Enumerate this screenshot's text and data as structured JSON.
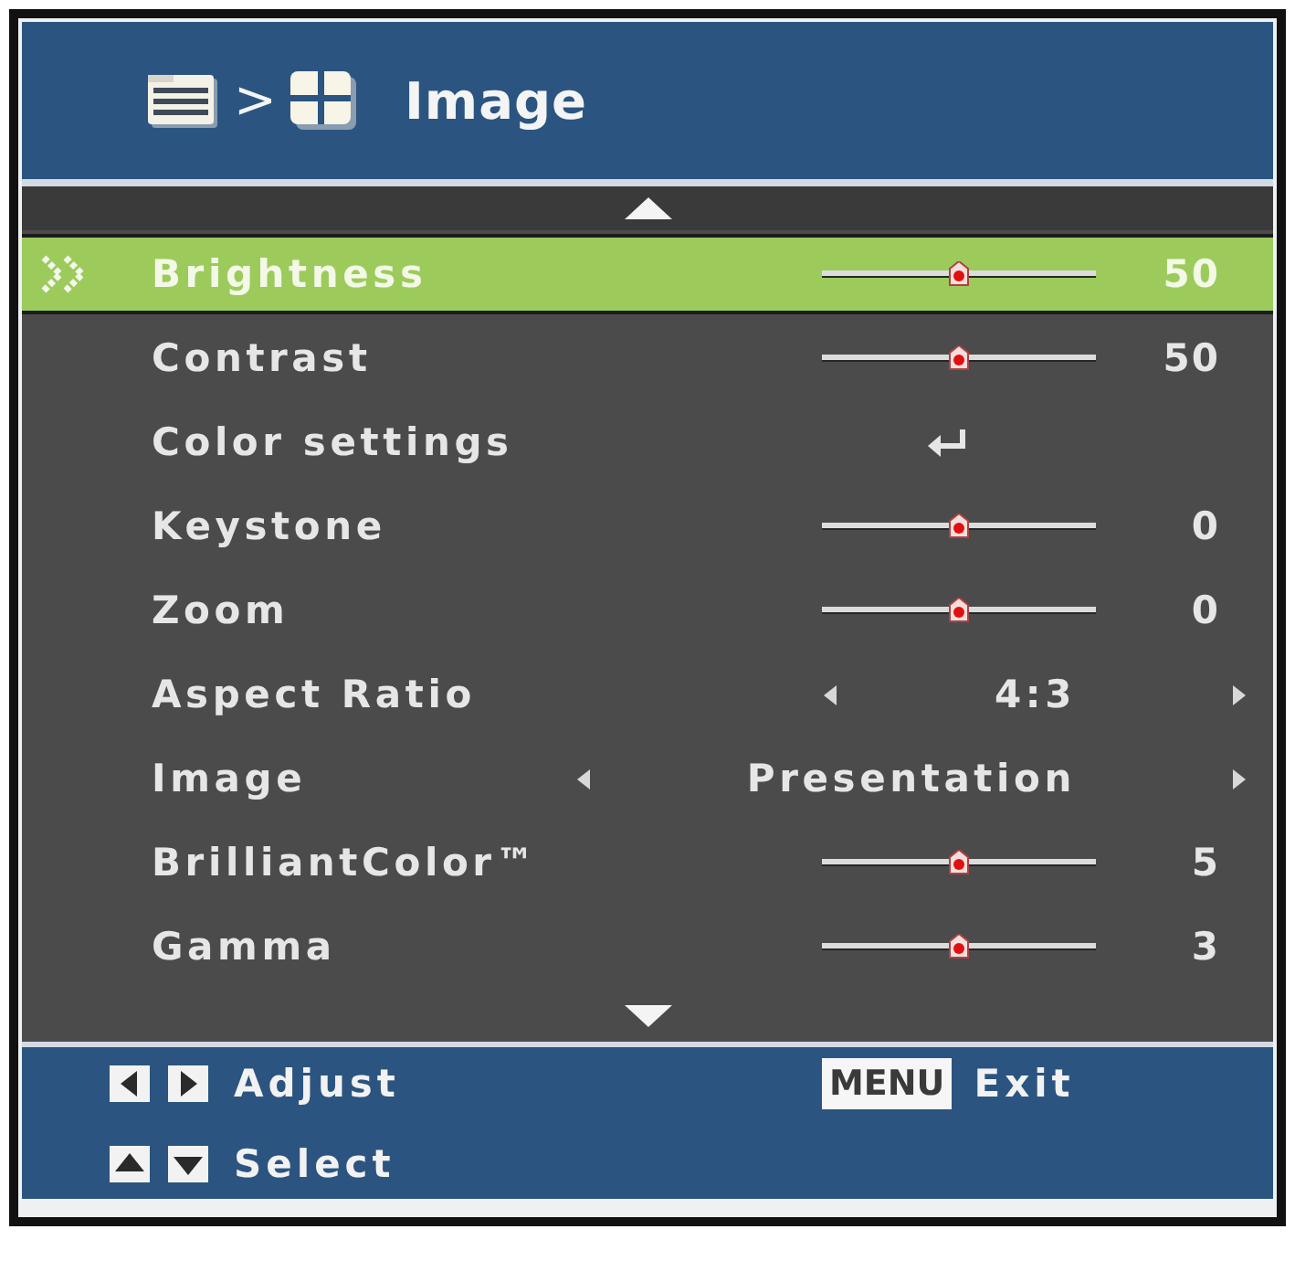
{
  "header": {
    "separator": ">",
    "title": "Image"
  },
  "menu": {
    "items": [
      {
        "kind": "slider",
        "label": "Brightness",
        "selected": true,
        "level": 0.5,
        "value": "50"
      },
      {
        "kind": "slider",
        "label": "Contrast",
        "selected": false,
        "level": 0.5,
        "value": "50"
      },
      {
        "kind": "submenu",
        "label": "Color settings",
        "selected": false
      },
      {
        "kind": "slider",
        "label": "Keystone",
        "selected": false,
        "level": 0.5,
        "value": "0"
      },
      {
        "kind": "slider",
        "label": "Zoom",
        "selected": false,
        "level": 0.5,
        "value": "0"
      },
      {
        "kind": "choice",
        "label": "Aspect Ratio",
        "selected": false,
        "value": "4:3"
      },
      {
        "kind": "choice",
        "label": "Image",
        "selected": false,
        "value": "Presentation"
      },
      {
        "kind": "slider",
        "label": "BrilliantColor™",
        "selected": false,
        "level": 0.5,
        "value": "5"
      },
      {
        "kind": "slider",
        "label": "Gamma",
        "selected": false,
        "level": 0.5,
        "value": "3"
      }
    ]
  },
  "footer": {
    "hints": [
      {
        "kind": "horizontal-arrows",
        "label": "Adjust"
      },
      {
        "kind": "key",
        "key": "MENU",
        "label": "Exit"
      },
      {
        "kind": "vertical-arrows",
        "label": "Select"
      }
    ]
  }
}
